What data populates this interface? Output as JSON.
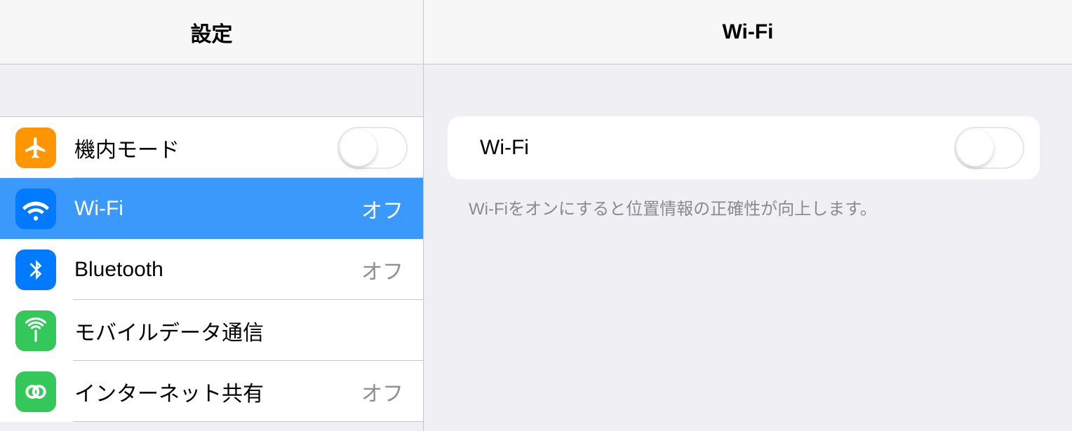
{
  "sidebar": {
    "title": "設定",
    "items": [
      {
        "label": "機内モード",
        "value": ""
      },
      {
        "label": "Wi-Fi",
        "value": "オフ"
      },
      {
        "label": "Bluetooth",
        "value": "オフ"
      },
      {
        "label": "モバイルデータ通信",
        "value": ""
      },
      {
        "label": "インターネット共有",
        "value": "オフ"
      }
    ]
  },
  "detail": {
    "title": "Wi-Fi",
    "toggle_label": "Wi-Fi",
    "footer": "Wi-Fiをオンにすると位置情報の正確性が向上します。"
  }
}
